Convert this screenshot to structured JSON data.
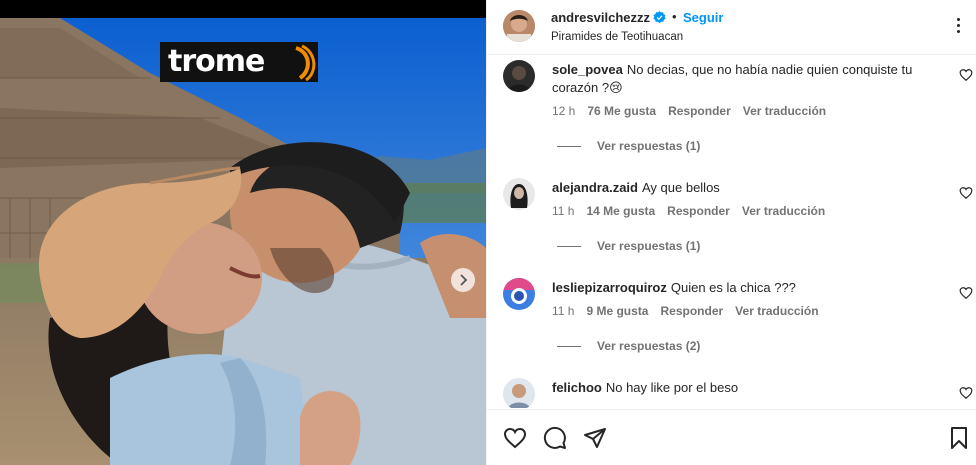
{
  "photo": {
    "logo_text": "trome",
    "next_icon": "chevron-right-icon"
  },
  "header": {
    "username": "andresvilchezzz",
    "separator": "•",
    "follow_label": "Seguir",
    "location": "Piramides de Teotihuacan"
  },
  "comments": [
    {
      "username": "sole_povea",
      "text": "No decias, que no había nadie quien conquiste tu corazón ?😢",
      "time": "12 h",
      "likes": "76 Me gusta",
      "reply_label": "Responder",
      "translate_label": "Ver traducción",
      "view_replies": "Ver respuestas (1)"
    },
    {
      "username": "alejandra.zaid",
      "text": "Ay que bellos",
      "time": "11 h",
      "likes": "14 Me gusta",
      "reply_label": "Responder",
      "translate_label": "Ver traducción",
      "view_replies": "Ver respuestas (1)"
    },
    {
      "username": "lesliepizarroquiroz",
      "text": "Quien es la chica ???",
      "time": "11 h",
      "likes": "9 Me gusta",
      "reply_label": "Responder",
      "translate_label": "Ver traducción",
      "view_replies": "Ver respuestas (2)"
    },
    {
      "username": "felichoo",
      "text": "No hay like por el beso"
    }
  ],
  "colors": {
    "accent": "#0095f6",
    "verified": "#0095f6",
    "secondary_text": "#737373",
    "logo_orange": "#f28c00"
  },
  "icons": [
    "heart-icon",
    "comment-icon",
    "share-icon",
    "bookmark-icon",
    "more-options-icon",
    "verified-badge-icon"
  ]
}
